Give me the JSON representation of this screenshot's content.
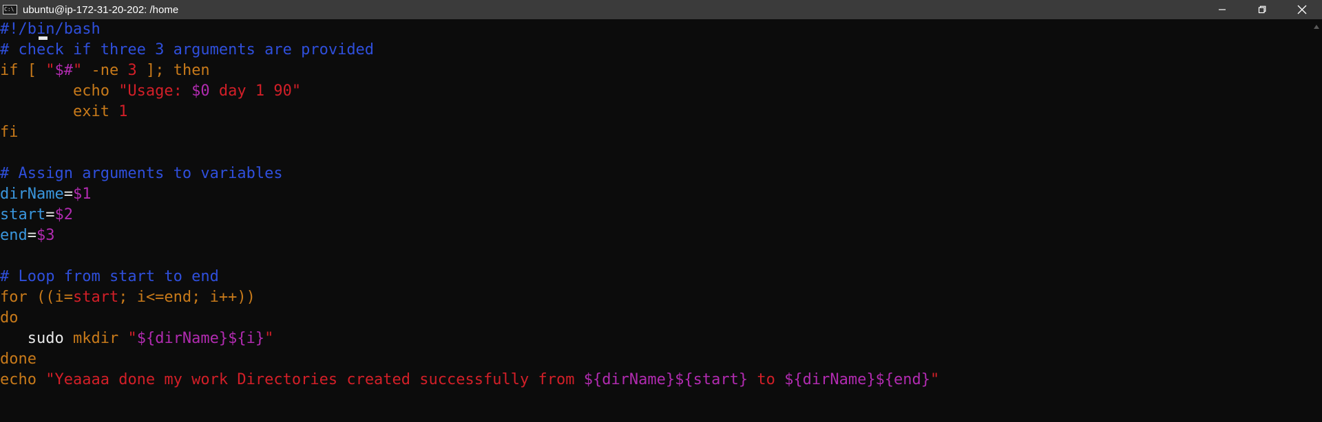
{
  "window": {
    "title": "ubuntu@ip-172-31-20-202: /home",
    "icon_label": "C:\\"
  },
  "controls": {
    "minimize_icon": "minimize-icon",
    "restore_icon": "restore-icon",
    "close_icon": "close-icon"
  },
  "colors": {
    "background": "#0c0c0c",
    "titlebar": "#3b3b3b",
    "comment": "#2f4fdc",
    "keyword": "#c87a1a",
    "variable": "#b12bb0",
    "string": "#d31f28",
    "identifier": "#3a96dd",
    "plain": "#e8e8e8"
  },
  "editor": {
    "lines": [
      [
        {
          "t": "#!/bin/bash",
          "c": "comment"
        }
      ],
      [
        {
          "t": "# check if three 3 arguments are provided",
          "c": "comment"
        }
      ],
      [
        {
          "t": "if [ ",
          "c": "kw"
        },
        {
          "t": "\"",
          "c": "str"
        },
        {
          "t": "$#",
          "c": "var"
        },
        {
          "t": "\"",
          "c": "str"
        },
        {
          "t": " -ne ",
          "c": "kw"
        },
        {
          "t": "3",
          "c": "str"
        },
        {
          "t": " ]; then",
          "c": "kw"
        }
      ],
      [
        {
          "t": "        echo ",
          "c": "kw"
        },
        {
          "t": "\"Usage: ",
          "c": "str"
        },
        {
          "t": "$0",
          "c": "var"
        },
        {
          "t": " day 1 90\"",
          "c": "str"
        }
      ],
      [
        {
          "t": "        exit ",
          "c": "kw"
        },
        {
          "t": "1",
          "c": "str"
        }
      ],
      [
        {
          "t": "fi",
          "c": "kw"
        }
      ],
      [
        {
          "t": "",
          "c": "plain"
        }
      ],
      [
        {
          "t": "# Assign arguments to variables",
          "c": "comment"
        }
      ],
      [
        {
          "t": "dirName",
          "c": "ident"
        },
        {
          "t": "=",
          "c": "plain"
        },
        {
          "t": "$1",
          "c": "var"
        }
      ],
      [
        {
          "t": "start",
          "c": "ident"
        },
        {
          "t": "=",
          "c": "plain"
        },
        {
          "t": "$2",
          "c": "var"
        }
      ],
      [
        {
          "t": "end",
          "c": "ident"
        },
        {
          "t": "=",
          "c": "plain"
        },
        {
          "t": "$3",
          "c": "var"
        }
      ],
      [
        {
          "t": "",
          "c": "plain"
        }
      ],
      [
        {
          "t": "# Loop from start to end",
          "c": "comment"
        }
      ],
      [
        {
          "t": "for ((i=",
          "c": "kw"
        },
        {
          "t": "start",
          "c": "str"
        },
        {
          "t": "; i<=end; i++))",
          "c": "kw"
        }
      ],
      [
        {
          "t": "do",
          "c": "kw"
        }
      ],
      [
        {
          "t": "   sudo ",
          "c": "plain"
        },
        {
          "t": "mkdir ",
          "c": "kw"
        },
        {
          "t": "\"",
          "c": "str"
        },
        {
          "t": "${dirName}${i}",
          "c": "var"
        },
        {
          "t": "\"",
          "c": "str"
        }
      ],
      [
        {
          "t": "done",
          "c": "kw"
        }
      ],
      [
        {
          "t": "echo ",
          "c": "kw"
        },
        {
          "t": "\"Yeaaaa done my work Directories created successfully from ",
          "c": "str"
        },
        {
          "t": "${dirName}${start}",
          "c": "var"
        },
        {
          "t": " to ",
          "c": "str"
        },
        {
          "t": "${dirName}${end}",
          "c": "var"
        },
        {
          "t": "\"",
          "c": "str"
        }
      ]
    ]
  }
}
